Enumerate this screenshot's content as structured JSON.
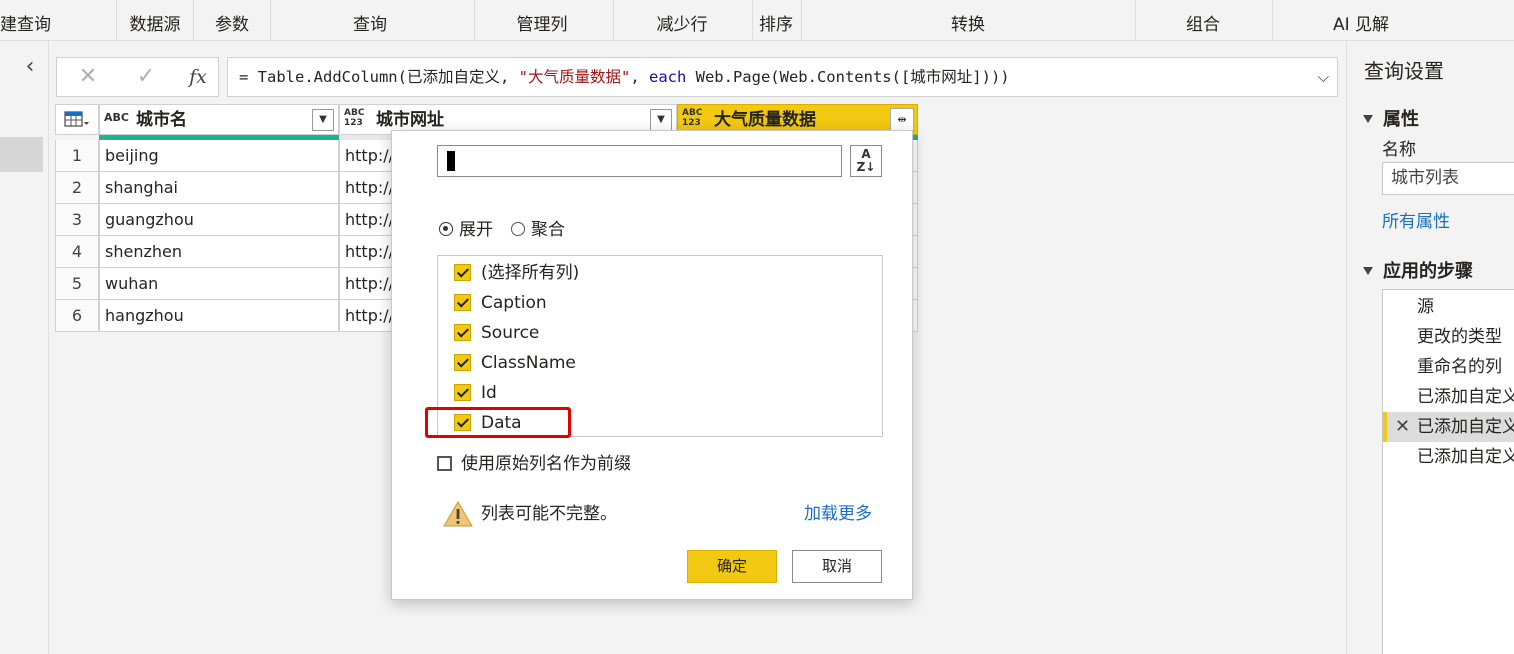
{
  "ribbon": {
    "groups": [
      "建查询",
      "数据源",
      "参数",
      "查询",
      "管理列",
      "减少行",
      "排序",
      "转换",
      "组合",
      "AI 见解"
    ]
  },
  "formula_bar": {
    "cancel_icon": "x-icon",
    "confirm_icon": "check-icon",
    "fx_label": "fx",
    "text_prefix": "= Table.AddColumn(已添加自定义, ",
    "text_string": "\"大气质量数据\"",
    "text_mid": ", ",
    "text_keyword": "each",
    "text_suffix": " Web.Page(Web.Contents([城市网址])))"
  },
  "grid": {
    "columns": [
      {
        "type_label": "ABC",
        "name": "城市名"
      },
      {
        "type_label": "ABC\n123",
        "name": "城市网址"
      },
      {
        "type_label": "ABC\n123",
        "name": "大气质量数据"
      }
    ],
    "rows": [
      {
        "num": "1",
        "city": "beijing",
        "url": "http://"
      },
      {
        "num": "2",
        "city": "shanghai",
        "url": "http://"
      },
      {
        "num": "3",
        "city": "guangzhou",
        "url": "http://"
      },
      {
        "num": "4",
        "city": "shenzhen",
        "url": "http://"
      },
      {
        "num": "5",
        "city": "wuhan",
        "url": "http://"
      },
      {
        "num": "6",
        "city": "hangzhou",
        "url": "http://"
      }
    ]
  },
  "expand_dialog": {
    "search_value": "",
    "sort_label": "A\nZ↓",
    "radio_expand": "展开",
    "radio_aggregate": "聚合",
    "selected_mode": "展开",
    "columns": [
      {
        "label": "(选择所有列)",
        "checked": true
      },
      {
        "label": "Caption",
        "checked": true
      },
      {
        "label": "Source",
        "checked": true
      },
      {
        "label": "ClassName",
        "checked": true
      },
      {
        "label": "Id",
        "checked": true
      },
      {
        "label": "Data",
        "checked": true
      }
    ],
    "prefix_label": "使用原始列名作为前缀",
    "prefix_checked": false,
    "warning_text": "列表可能不完整。",
    "load_more": "加载更多",
    "ok_label": "确定",
    "cancel_label": "取消",
    "highlight_color": "#e30000"
  },
  "query_settings": {
    "title": "查询设置",
    "properties_header": "属性",
    "name_label": "名称",
    "name_value": "城市列表",
    "all_properties": "所有属性",
    "steps_header": "应用的步骤",
    "steps": [
      {
        "label": "源",
        "selected": false
      },
      {
        "label": "更改的类型",
        "selected": false
      },
      {
        "label": "重命名的列",
        "selected": false
      },
      {
        "label": "已添加自定义",
        "selected": false
      },
      {
        "label": "已添加自定义",
        "selected": true
      },
      {
        "label": "已添加自定义",
        "selected": false
      }
    ]
  },
  "colors": {
    "accent": "#f2c811",
    "link": "#1a6fc4",
    "quality_bar": "#1ab394"
  }
}
